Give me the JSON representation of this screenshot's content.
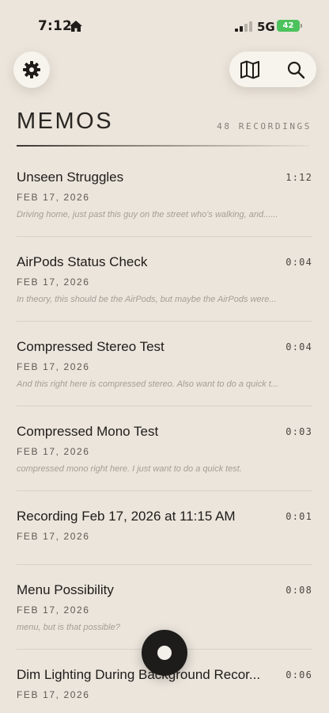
{
  "status_bar": {
    "time": "7:12",
    "network": "5G",
    "battery": "42"
  },
  "icons": {
    "settings": "gear-icon",
    "map": "map-icon",
    "search": "search-icon",
    "home": "home-icon",
    "record": "record-icon"
  },
  "colors": {
    "background": "#ebe5dc",
    "battery": "#4cc25c",
    "record_button": "#1e1c1a"
  },
  "header": {
    "title": "MEMOS",
    "count": "48 RECORDINGS"
  },
  "memos": [
    {
      "title": "Unseen Struggles",
      "duration": "1:12",
      "date": "FEB 17, 2026",
      "preview": "Driving home, just past this guy on the street who's walking, and......"
    },
    {
      "title": "AirPods Status Check",
      "duration": "0:04",
      "date": "FEB 17, 2026",
      "preview": "In theory, this should be the AirPods, but maybe the AirPods were..."
    },
    {
      "title": "Compressed Stereo Test",
      "duration": "0:04",
      "date": "FEB 17, 2026",
      "preview": "And this right here is compressed stereo. Also want to do a quick t..."
    },
    {
      "title": "Compressed Mono Test",
      "duration": "0:03",
      "date": "FEB 17, 2026",
      "preview": "compressed mono right here. I just want to do a quick test."
    },
    {
      "title": "Recording Feb 17, 2026 at 11:15 AM",
      "duration": "0:01",
      "date": "FEB 17, 2026",
      "preview": ""
    },
    {
      "title": "Menu Possibility",
      "duration": "0:08",
      "date": "FEB 17, 2026",
      "preview": "menu, but is that possible?"
    },
    {
      "title": "Dim Lighting During Background Recor...",
      "duration": "0:06",
      "date": "FEB 17, 2026",
      "preview": ""
    }
  ]
}
